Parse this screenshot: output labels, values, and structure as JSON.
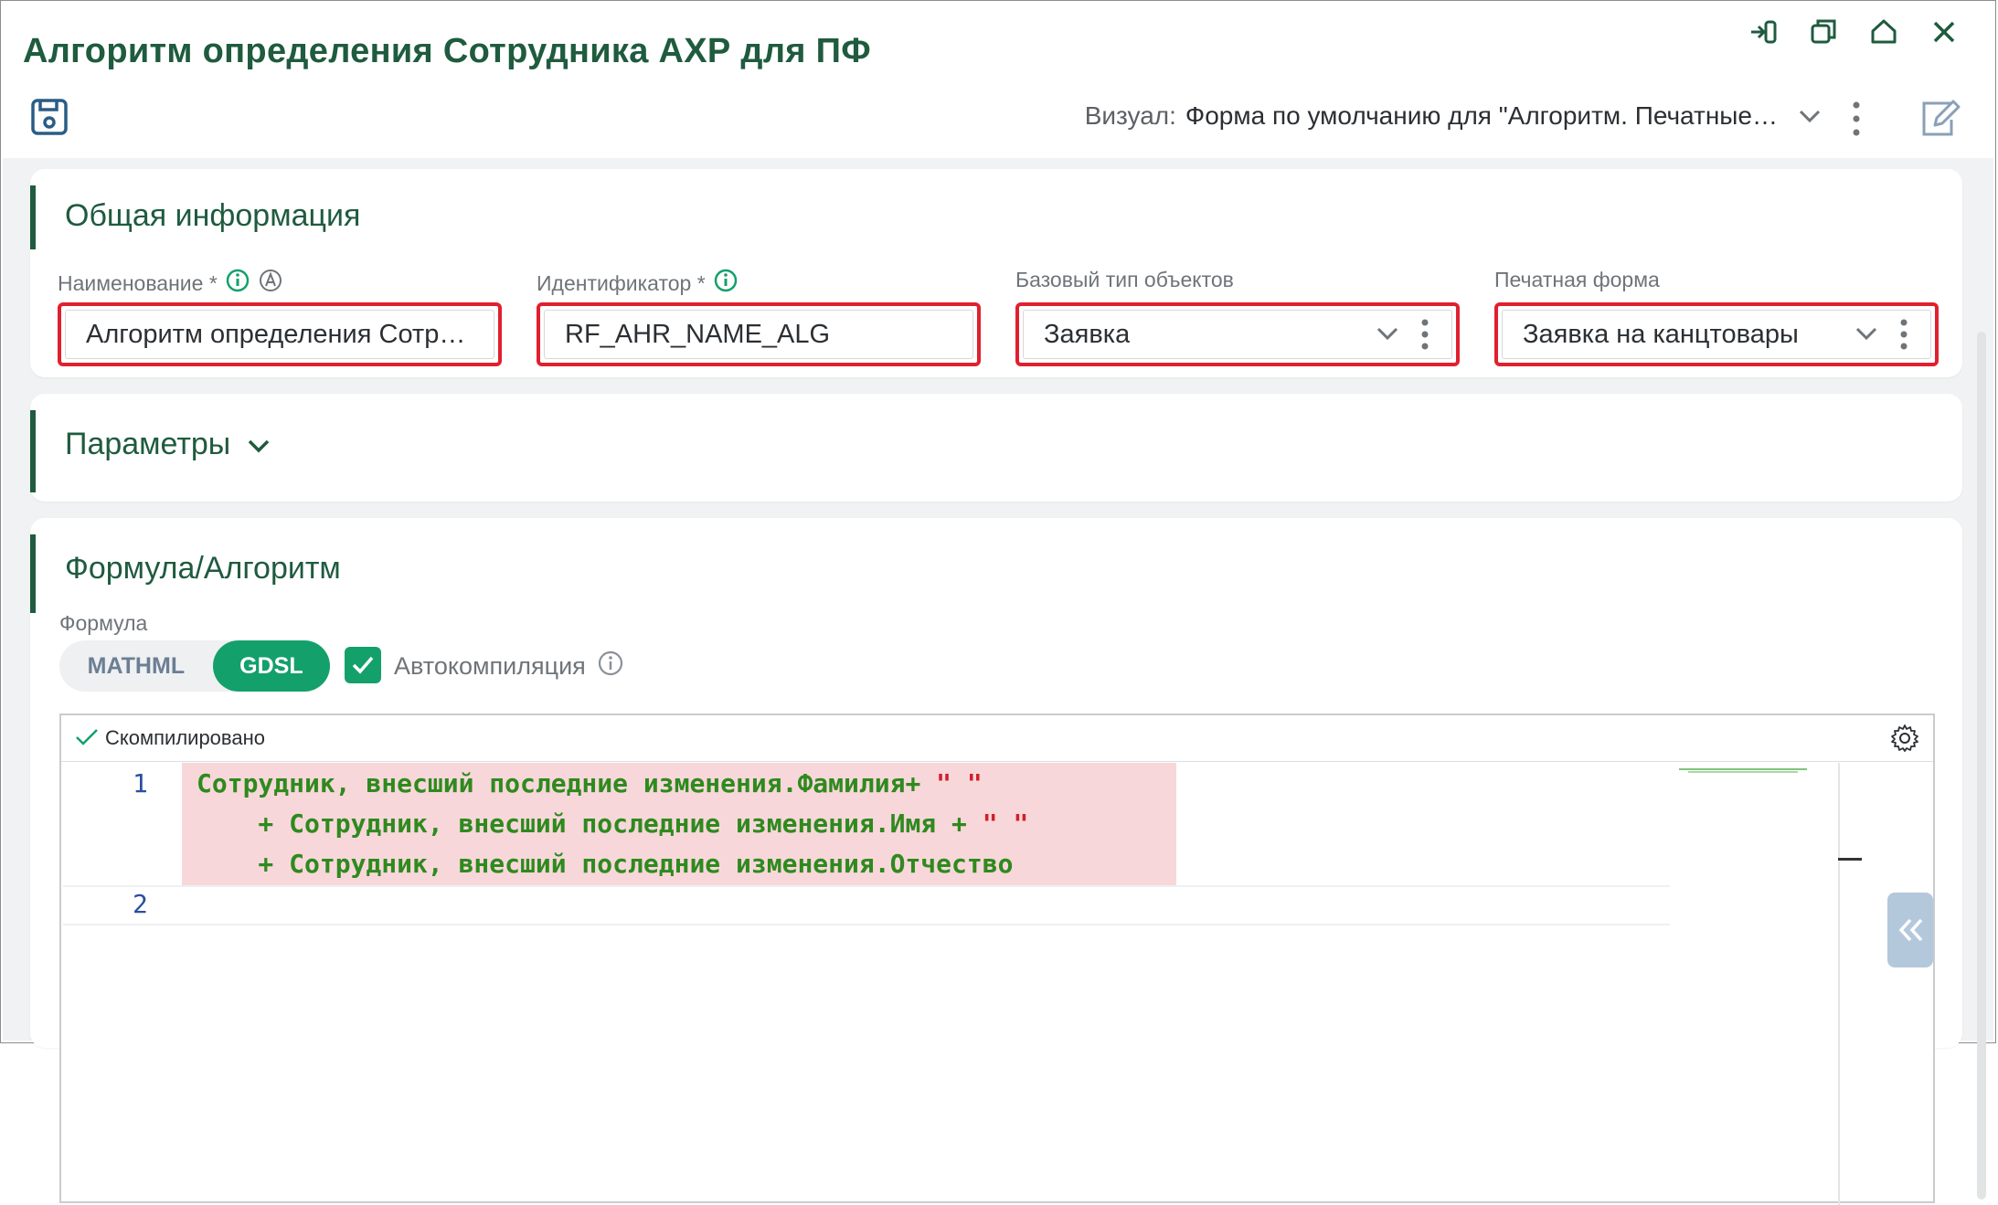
{
  "window": {
    "title": "Алгоритм определения Сотрудника АХР для ПФ"
  },
  "toolbar": {
    "visual_label": "Визуал:",
    "visual_value": "Форма по умолчанию для \"Алгоритм. Печатные…"
  },
  "general": {
    "title": "Общая информация",
    "fields": [
      {
        "label": "Наименование *",
        "value": "Алгоритм определения Сотр…"
      },
      {
        "label": "Идентификатор *",
        "value": "RF_AHR_NAME_ALG"
      },
      {
        "label": "Базовый тип объектов",
        "value": "Заявка"
      },
      {
        "label": "Печатная форма",
        "value": "Заявка на канцтовары"
      }
    ]
  },
  "params": {
    "title": "Параметры"
  },
  "formula": {
    "title": "Формула/Алгоритм",
    "label": "Формула",
    "toggle": [
      "MATHML",
      "GDSL"
    ],
    "toggle_selected": "GDSL",
    "autocompile_label": "Автокомпиляция",
    "autocompile_checked": true,
    "status": "Скомпилировано",
    "line_numbers": [
      "1",
      "2"
    ],
    "code": [
      {
        "text": "Сотрудник, внесший последние изменения.Фамилия+ ",
        "quote": "\" \""
      },
      {
        "text": "    + Сотрудник, внесший последние изменения.Имя + ",
        "quote": "\" \""
      },
      {
        "text": "    + Сотрудник, внесший последние изменения.Отчество",
        "quote": ""
      }
    ]
  },
  "colors": {
    "accent": "#1f5b3e",
    "primary": "#14a06b",
    "error_border": "#e0202f",
    "code_bg": "#f8d7da"
  }
}
